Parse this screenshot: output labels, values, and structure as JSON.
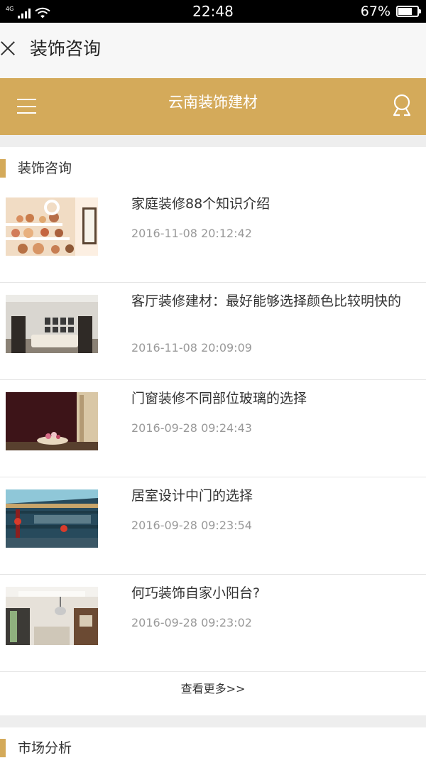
{
  "status_bar": {
    "network": "4G",
    "time": "22:48",
    "battery_percent": "67%",
    "battery_level": 0.67
  },
  "titlebar": {
    "title": "装饰咨询",
    "close_icon": "close-icon"
  },
  "header": {
    "title": "云南装饰建材",
    "menu_icon": "menu-icon",
    "user_icon": "user-icon",
    "color": "#d4aa5a"
  },
  "news_section": {
    "title": "装饰咨询",
    "items": [
      {
        "title": "家庭装修88个知识介绍",
        "date": "2016-11-08 20:12:42"
      },
      {
        "title": "客厅装修建材：最好能够选择颜色比较明快的",
        "date": "2016-11-08 20:09:09"
      },
      {
        "title": "门窗装修不同部位玻璃的选择",
        "date": "2016-09-28 09:24:43"
      },
      {
        "title": "居室设计中门的选择",
        "date": "2016-09-28 09:23:54"
      },
      {
        "title": "何巧装饰自家小阳台?",
        "date": "2016-09-28 09:23:02"
      }
    ],
    "more_label": "查看更多>>"
  },
  "market_section": {
    "title": "市场分析"
  }
}
